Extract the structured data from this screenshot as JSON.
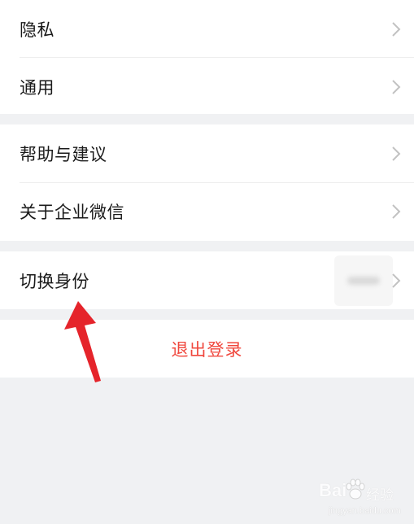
{
  "settings": {
    "group1": [
      {
        "label": "隐私"
      },
      {
        "label": "通用"
      }
    ],
    "group2": [
      {
        "label": "帮助与建议"
      },
      {
        "label": "关于企业微信"
      }
    ],
    "group3": [
      {
        "label": "切换身份"
      }
    ],
    "logout_label": "退出登录"
  },
  "icons": {
    "chevron": "chevron-right-icon",
    "annotation": "red-arrow-annotation"
  },
  "colors": {
    "background": "#f0f1f3",
    "row_background": "#ffffff",
    "text": "#1a1a1a",
    "logout_text": "#f0483e",
    "chevron": "#c2c2c2",
    "annotation_arrow": "#e5242b"
  },
  "watermark": {
    "brand": "Bai",
    "sub": "经验",
    "url": "jingyan.baidu.com"
  }
}
